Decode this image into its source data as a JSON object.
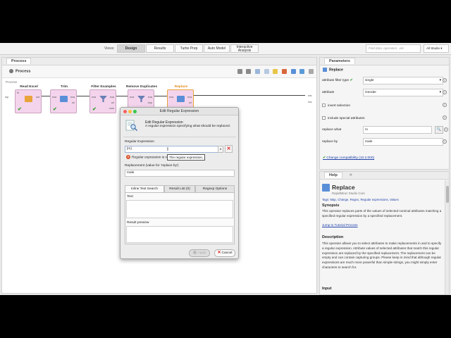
{
  "topbar": {
    "views_label": "Views:",
    "views": [
      {
        "label": "Design",
        "active": true
      },
      {
        "label": "Results",
        "active": false
      },
      {
        "label": "Turbo Prep",
        "active": false
      },
      {
        "label": "Auto Model",
        "active": false
      },
      {
        "label": "Interactive Analysis",
        "active": false
      }
    ],
    "search_placeholder": "Find data, operators...etc",
    "studio_select": "All Studio"
  },
  "process_panel": {
    "tab": "Process",
    "title": "Process",
    "canvas_label": "Process",
    "left_port": "inp",
    "right_ports": [
      "res",
      "res"
    ],
    "operators": [
      {
        "name": "Read Excel",
        "ports_in": [
          "fil"
        ],
        "ports_out": [
          "out"
        ],
        "checked": true,
        "color": "#e8a33a"
      },
      {
        "name": "Trim",
        "ports_in": [
          "exa"
        ],
        "ports_out": [
          "exa",
          "ori"
        ],
        "checked": true,
        "color": "#5a8fd8"
      },
      {
        "name": "Filter Examples",
        "ports_in": [
          "exa"
        ],
        "ports_out": [
          "exa",
          "ori",
          "unm"
        ],
        "checked": true,
        "color": "#6a7fb5"
      },
      {
        "name": "Remove Duplicates",
        "ports_in": [
          "exa"
        ],
        "ports_out": [
          "exa",
          "dup",
          "ori"
        ],
        "checked": true,
        "color": "#6a7fb5"
      },
      {
        "name": "Replace",
        "ports_in": [
          "exa"
        ],
        "ports_out": [
          "exa",
          "ori"
        ],
        "checked": false,
        "color": "#5a8fd8"
      }
    ]
  },
  "parameters": {
    "tab": "Parameters",
    "operator": "Replace",
    "rows": {
      "attribute_filter_type": {
        "label": "attribute filter type",
        "value": "single"
      },
      "attribute": {
        "label": "attribute",
        "value": "Gender"
      },
      "invert_selection": {
        "label": "invert selection"
      },
      "include_special": {
        "label": "include special attributes"
      },
      "replace_what": {
        "label": "replace what",
        "value": "m"
      },
      "replace_by": {
        "label": "replace by",
        "value": "male"
      }
    },
    "compat": "Change compatibility (10.2.000)"
  },
  "help": {
    "tab": "Help",
    "title": "Replace",
    "subtitle": "RapidMiner Studio Core",
    "tags": "Tags: Map, Change, Regex, Regular expressions, Values",
    "synopsis_h": "Synopsis",
    "synopsis": "This operator replaces parts of the values of selected nominal attributes matching a specified regular expression by a specified replacement.",
    "tutorial_link": "Jump to Tutorial Process",
    "description_h": "Description",
    "description": "This operator allows you to select attributes to make replacements in and to specify a regular expression. Attribute values of selected attributes that match this regular expression are replaced by the specified replacement. The replacement can be empty and can contain capturing groups. Please keep in mind that although regular expressions are much more powerful than simple strings, you might simply enter characters to search for.",
    "input_h": "Input"
  },
  "dialog": {
    "title": "Edit Regular Expression",
    "head_title": "Edit Regular Expression",
    "head_desc": "A regular expression specifying what should be replaced.",
    "regex_label": "Regular Expression",
    "regex_value": "[m]",
    "status_text": "Regular expression is valid expression!",
    "tooltip": "The regular expression.",
    "replacement_label": "Replacement (value for 'replace by')",
    "replacement_value": "male",
    "tabs": [
      "Inline Text Search",
      "Result List (0)",
      "Regexp Options"
    ],
    "text_label": "Text",
    "preview_label": "Result preview",
    "apply_label": "Apply",
    "cancel_label": "Cancel"
  },
  "colors": {
    "operator_fill": "#f4d4ec",
    "check_green": "#2ea12e",
    "link_blue": "#2244aa",
    "error_red": "#d22222"
  }
}
